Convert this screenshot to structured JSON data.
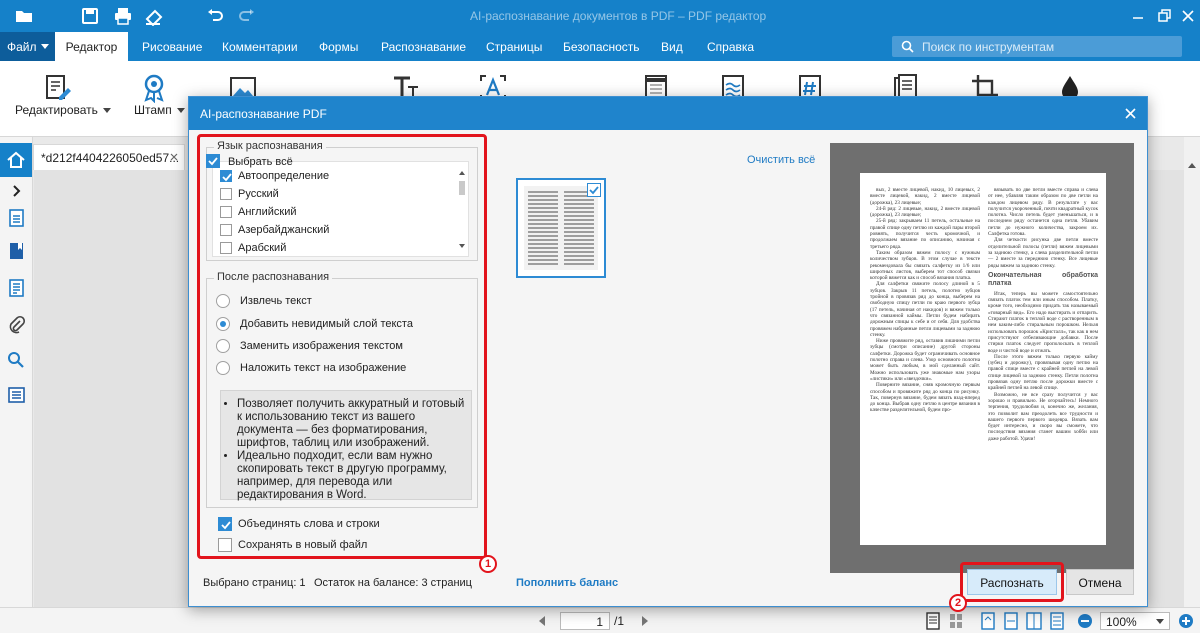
{
  "app": {
    "window_title": "AI-распознавание документов в PDF – PDF редактор"
  },
  "menubar": {
    "file_label": "Файл",
    "tabs": [
      "Редактор",
      "Рисование",
      "Комментарии",
      "Формы",
      "Распознавание",
      "Страницы",
      "Безопасность",
      "Вид",
      "Справка"
    ],
    "active_tab": "Редактор",
    "search_placeholder": "Поиск по инструментам"
  },
  "ribbon": {
    "edit_label": "Редактировать",
    "stamp_label": "Штамп"
  },
  "document_tab": {
    "name": "*d212f4404226050ed57..."
  },
  "dialog": {
    "title": "AI-распознавание PDF",
    "language_group": {
      "legend": "Язык распознавания",
      "options": [
        {
          "label": "Автоопределение",
          "checked": true
        },
        {
          "label": "Русский",
          "checked": false
        },
        {
          "label": "Английский",
          "checked": false
        },
        {
          "label": "Азербайджанский",
          "checked": false
        },
        {
          "label": "Арабский",
          "checked": false
        }
      ]
    },
    "after_group": {
      "legend": "После распознавания",
      "options": [
        {
          "label": "Извлечь текст",
          "selected": false
        },
        {
          "label": "Добавить невидимый слой текста",
          "selected": true
        },
        {
          "label": "Заменить изображения текстом",
          "selected": false
        },
        {
          "label": "Наложить текст на изображение",
          "selected": false
        }
      ],
      "info": [
        "Позволяет получить аккуратный и готовый к использованию текст из вашего документа — без форматирования, шрифтов, таблиц или изображений.",
        "Идеально подходит, если вам нужно скопировать текст в другую программу, например, для перевода или редактирования в Word."
      ]
    },
    "merge_words": {
      "label": "Объединять слова и строки",
      "checked": true
    },
    "save_new_file": {
      "label": "Сохранять в новый файл",
      "checked": false
    },
    "select_all": {
      "label": "Выбрать всё",
      "checked": true
    },
    "clear_all": "Очистить всё",
    "pages_selected": "Выбрано страниц: 1",
    "balance": "Остаток на балансе: 3 страниц",
    "refill": "Пополнить баланс",
    "recognize_button": "Распознать",
    "cancel_button": "Отмена",
    "markers": [
      "1",
      "2"
    ],
    "preview_text": {
      "col1": [
        "вых, 2 вместе лицевой, накид, 10 лицевых, 2 вместе лицевой, накид, 2 вместе лицевой (дорожка), 23 лицевые;",
        "24-й ряд: 2 лицевые, накид, 2 вместе лицевой (дорожка), 23 лицевые;",
        "25-й ряд: закрываем 11 петель, остальные на правой спице одну петлю из каждой пары второй ровнять, получится честь кромочной, и продолжаем вязание по описанию, начиная с третьего ряда.",
        "Таким образом вяжем полосу с нужным количеством зубцов. В этом случае в тексте рекомендовала бы связать салфетку из 1/6 или широтных листов, выберем тот способ связки которой вяжется как и способ вязания платка.",
        "Для салфетки свяжите полосу длиной в 5 зубцов. Закрыв 11 петель, полотно зубцов тройной в провязав ряд до конца, выберем на свободную спицу петли по краю первого зубца (17 петель, начиная от накидов) и вяжем только что связанной каймы. Петли будем набирать дорожным спицы к себе и от себя. Для удобства провяжем набранные петли лицевыми за заднюю стенку.",
        "Ниже провяжите ряд, оставив лишними петли зубцы (смотри описание) другой стороны салфетки. Дорожка будет ограничивать основное полотно справа и слева. Узор основного полотна может быть любым, в мой сделанный сайт. Можно использовать уже знакомые нам узоры «листики» или «звездочки».",
        "Поверните вязание, сняв кромочную первым способом и провяжите ряд до конца по рисунку. Так, повернув вязание, будем вязать взад-вперед до конца. Выбрав одну петлю в центре вязания в качестве разделительной, будем про-"
      ],
      "col2": [
        "вязывать по две петли вместе справа и слева от нее, убавляя таким образом по две петли на каждом лицевом ряду. В результате у вас получится укороченный, почти квадратный кусок полотна. Число петель будет уменьшаться, и в последнем ряду останется одна петля. Убавим петли до нужного количества, закроем их. Салфетка готова.",
        "Для четкости рисунка две петли вместе отделительной полосы (петли) вяжем лицевыми за заднюю стенку, а слева разделительной петли — 2 вместе за переднюю стенку. Все лицевые ряды вяжем за заднюю стенку.",
        "Окончательная обработка платка",
        "Итак, теперь вы можете самостоятельно связать платок тем или иным способом. Платку, кроме того, необходимо придать так называемый «товарный вид». Его надо выстирать и отпарить. Стирают платок в теплой воде с растворенным в нем каким-либо стиральным порошком. Нельзя использовать порошок «Кристалл», так как в нем присутствуют отбеливающие добавки. После стирки платок следует прополоскать в теплой воде и чистой воде и отжать.",
        "После этого вяжем только первую кайму (зубец и дорожку), провязывая одну петлю на правой спице вместе с крайней петлей на левой спице лицевой за заднюю стенку. Петли полотна провязав одну петлю после дорожки вместе с крайней петлей на левой спице.",
        "Возможно, не все сразу получится у вас хорошо и правильно. Не огорчайтесь! Немного терпения, трудолюбия и, конечно же, желания, это позволит вам преодолеть все трудности и вашего первого первого шедевра. Вязать вам будет интересно, и скоро вы сможете, что последствия вязания станет вашим хобби или даже работой. Удачи!"
      ]
    }
  },
  "statusbar": {
    "page_current": "1",
    "page_total": "/1",
    "zoom": "100%"
  },
  "colors": {
    "accent": "#1581c9",
    "highlight": "#e2141c",
    "checkbox": "#2d8bd4"
  }
}
